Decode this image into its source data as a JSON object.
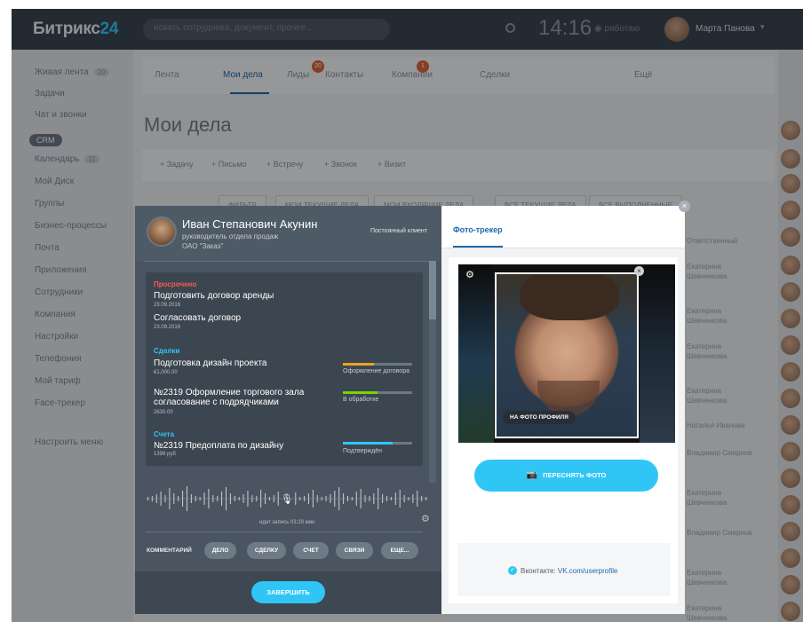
{
  "app": {
    "logo_text": "Битрикс",
    "logo_number": "24",
    "search_placeholder": "искать сотрудника, документ, прочее...",
    "clock": "14:16",
    "status": "работаю",
    "user_name": "Марта Панова"
  },
  "sidebar": {
    "items": [
      {
        "label": "Живая лента",
        "badge": "20"
      },
      {
        "label": "Задачи",
        "badge": ""
      },
      {
        "label": "Чат и звонки",
        "badge": ""
      },
      {
        "label": "CRM",
        "badge": ""
      },
      {
        "label": "Календарь",
        "badge": "11"
      },
      {
        "label": "Мой Диск",
        "badge": ""
      },
      {
        "label": "Группы",
        "badge": ""
      },
      {
        "label": "Бизнес-процессы",
        "badge": ""
      },
      {
        "label": "Почта",
        "badge": ""
      },
      {
        "label": "Приложения",
        "badge": ""
      },
      {
        "label": "Сотрудники",
        "badge": ""
      },
      {
        "label": "Компания",
        "badge": ""
      },
      {
        "label": "Настройки",
        "badge": ""
      },
      {
        "label": "Телефония",
        "badge": ""
      },
      {
        "label": "Мой тариф",
        "badge": ""
      },
      {
        "label": "Face-трекер",
        "badge": ""
      },
      {
        "label": "Настроить меню",
        "badge": ""
      }
    ]
  },
  "main": {
    "tabs": [
      {
        "label": "Лента",
        "count": ""
      },
      {
        "label": "Мои дела",
        "count": ""
      },
      {
        "label": "Лиды",
        "count": "20"
      },
      {
        "label": "Контакты",
        "count": ""
      },
      {
        "label": "Компании",
        "count": "1"
      },
      {
        "label": "Сделки",
        "count": ""
      },
      {
        "label": "Ещё",
        "count": ""
      }
    ],
    "page_title": "Мои дела",
    "add_items": [
      "+ Задачу",
      "+ Письмо",
      "+ Встречу",
      "+ Звонок",
      "+ Визит"
    ],
    "filters": [
      "ФИЛЬТР",
      "МОИ ТЕКУЩИЕ ДЕЛА",
      "МОИ ВХОДЯЩИЕ ДЕЛА",
      "ВСЕ ТЕКУЩИЕ ДЕЛА",
      "ВСЕ ВЫПОЛНЕННЫЕ"
    ]
  },
  "background_list": {
    "header": "Ответственный",
    "rows": [
      "Екатерина Шевченкова",
      "Екатерина Шевченкова",
      "Екатерина Шевченкова",
      "Екатерина Шевченкова",
      "Наталья Иванова",
      "Владимир Смирнов",
      "Екатерина Шевченкова",
      "Владимир Смирнов",
      "Екатерина Шевченкова",
      "Екатерина Шевченкова"
    ]
  },
  "contact": {
    "name": "Иван Степанович Акунин",
    "role": "руководитель отдела продаж",
    "company": "ОАО \"Заказ\"",
    "client_type": "Постоянный клиент"
  },
  "activities": {
    "overdue_title": "Просрочено",
    "overdue": [
      {
        "title": "Подготовить договор аренды",
        "date": "23.09.2016"
      },
      {
        "title": "Согласовать договор",
        "date": "23.09.2016"
      }
    ],
    "deals_title": "Сделки",
    "deals": [
      {
        "title": "Подготовка дизайн проекта",
        "amount": "€1,000.00",
        "stage": "Оформление договора",
        "progress": 0.45,
        "color": "#f0a020"
      },
      {
        "title": "№2319 Оформление торгового зала",
        "title2": "согласование с подрядчиками",
        "amount": "2630.00",
        "stage": "В обработке",
        "progress": 0.5,
        "color": "#7bd500"
      }
    ],
    "invoices_title": "Счета",
    "invoices": [
      {
        "title": "№2319 Предоплата по дизайну",
        "amount": "1398 руб",
        "stage": "Подтверждён",
        "progress": 0.72,
        "color": "#2fc6f6"
      }
    ]
  },
  "recording": {
    "status": "идет запись 03:29 мин"
  },
  "actions": {
    "comment_label": "КОММЕНТАРИЙ",
    "chips": [
      "ДЕЛО",
      "СДЕЛКУ",
      "СЧЕТ",
      "СВЯЗИ",
      "ЕЩЕ..."
    ],
    "finish_label": "ЗАВЕРШИТЬ"
  },
  "tracker": {
    "tab_label": "Фото-трекер",
    "profile_badge": "НА ФОТО ПРОФИЛЯ",
    "retake_label": "ПЕРЕСНЯТЬ ФОТО",
    "vk_label": "Вконтакте:",
    "vk_link": "VK.com/userprofile"
  },
  "colors": {
    "accent": "#2fc6f6",
    "link": "#2067b0",
    "overdue": "#ff5752"
  }
}
